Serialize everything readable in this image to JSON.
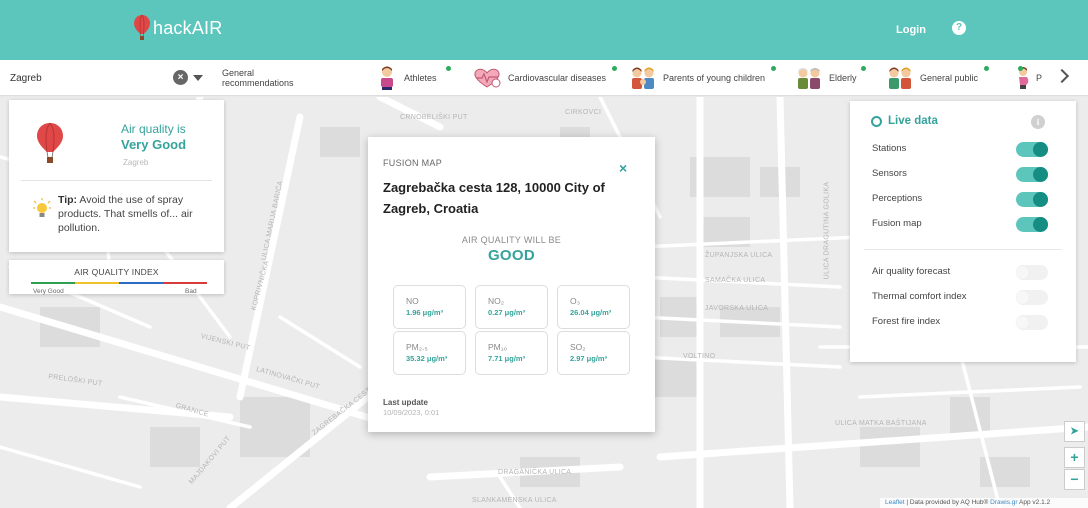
{
  "header": {
    "logo_text": "hackAIR",
    "login_label": "Login",
    "help_glyph": "?"
  },
  "recbar": {
    "city_value": "Zagreb",
    "general_label": "General recommendations",
    "tabs": [
      {
        "label": "Athletes",
        "icon": "athlete-icon"
      },
      {
        "label": "Cardiovascular diseases",
        "icon": "heart-icon"
      },
      {
        "label": "Parents of young children",
        "icon": "parents-icon"
      },
      {
        "label": "Elderly",
        "icon": "elderly-icon"
      },
      {
        "label": "General public",
        "icon": "general-public-icon"
      },
      {
        "label": "P",
        "icon": "pregnant-icon"
      }
    ]
  },
  "air_quality": {
    "line1": "Air quality is",
    "level": "Very Good",
    "city": "Zagreb",
    "tip_label": "Tip:",
    "tip_text": " Avoid the use of spray products. That smells of... air pollution."
  },
  "aq_index": {
    "title": "AIR QUALITY INDEX",
    "low": "Very Good",
    "high": "Bad",
    "colors": [
      "#2e9e4f",
      "#f2c229",
      "#2b6cc4",
      "#d93b3b"
    ]
  },
  "fusion": {
    "label": "FUSION MAP",
    "close": "×",
    "address": "Zagrebačka cesta 128, 10000 City of Zagreb, Croatia",
    "will_be": "AIR QUALITY WILL BE",
    "level": "GOOD",
    "pollutants": [
      {
        "name": "NO",
        "value": "1.96 μg/m³"
      },
      {
        "name": "NO₂",
        "value": "0.27 μg/m³"
      },
      {
        "name": "O₃",
        "value": "26.04 μg/m³"
      },
      {
        "name": "PM₂.₅",
        "value": "35.32 μg/m³"
      },
      {
        "name": "PM₁₀",
        "value": "7.71 μg/m³"
      },
      {
        "name": "SO₂",
        "value": "2.97 μg/m³"
      }
    ],
    "last_update_label": "Last update",
    "last_update_value": "10/09/2023, 0:01"
  },
  "live": {
    "title": "Live data",
    "info_glyph": "i",
    "layers": [
      {
        "label": "Stations",
        "on": true
      },
      {
        "label": "Sensors",
        "on": true
      },
      {
        "label": "Perceptions",
        "on": true
      },
      {
        "label": "Fusion map",
        "on": true
      }
    ],
    "extras": [
      {
        "label": "Air quality forecast",
        "on": false
      },
      {
        "label": "Thermal comfort index",
        "on": false
      },
      {
        "label": "Forest fire index",
        "on": false
      }
    ]
  },
  "map_controls": {
    "locate": "➤",
    "zoom_in": "+",
    "zoom_out": "−"
  },
  "attribution": {
    "leaflet": "Leaflet",
    "text": " | Data provided by AQ Hub® ",
    "drawis": "Drawis.gr",
    "app": " App v2.1.2"
  },
  "streets": [
    "CRNOBELIŠKI PUT",
    "CIRKOVCI",
    "ŽUPANJSKA ULICA",
    "SAMAČKA ULICA",
    "JAVORSKA ULICA",
    "VOLTINO",
    "VIJENSKI PUT",
    "PRELOŠKI PUT",
    "LATINOVAČKI PUT",
    "ZAGREBAČKA CESTA",
    "GRANICE",
    "MAJDAKOVI PUT",
    "DRAGANIČKA ULICA",
    "ULICA MATKA BAŠTIJANA",
    "ULICA DRAGUTINA GOLIKA",
    "SLANKAMENSKA ULICA",
    "ULICA MARIJA BARIĆA",
    "KOPRIVNIČKA"
  ]
}
